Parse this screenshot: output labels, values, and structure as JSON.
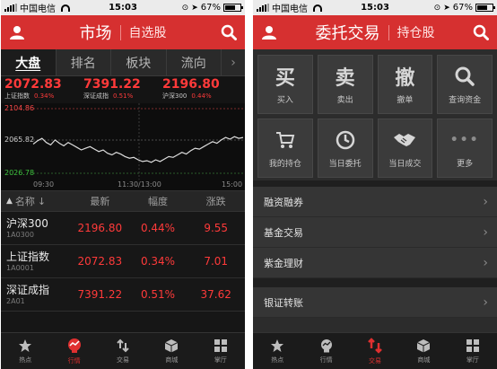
{
  "status_bar": {
    "carrier": "中国电信",
    "time": "15:03",
    "battery": "67%",
    "battery_level": 0.67
  },
  "market_screen": {
    "title": "市场",
    "subtitle": "自选股",
    "tabs": [
      "大盘",
      "排名",
      "板块",
      "流向"
    ],
    "tab_more": "›",
    "indices": [
      {
        "price": "2072.83",
        "name": "上证指数",
        "pct": "0.34%"
      },
      {
        "price": "7391.22",
        "name": "深证成指",
        "pct": "0.51%"
      },
      {
        "price": "2196.80",
        "name": "沪深300",
        "pct": "0.44%"
      }
    ],
    "chart_data": {
      "type": "line",
      "y_labels": [
        "2104.86",
        "2065.82",
        "2026.78"
      ],
      "ylim": [
        2026.78,
        2104.86
      ],
      "x_labels": [
        "09:30",
        "11:30/13:00",
        "15:00"
      ],
      "values": [
        2062,
        2066,
        2069,
        2064,
        2061,
        2067,
        2063,
        2060,
        2064,
        2061,
        2058,
        2055,
        2057,
        2059,
        2056,
        2053,
        2055,
        2051,
        2049,
        2052,
        2050,
        2047,
        2045,
        2046,
        2043,
        2041,
        2042,
        2040,
        2043,
        2041,
        2044,
        2047,
        2046,
        2049,
        2052,
        2050,
        2054,
        2057,
        2056,
        2059,
        2062,
        2065,
        2063,
        2067,
        2070,
        2068,
        2071,
        2069,
        2070
      ]
    },
    "list_header": {
      "name": "名称",
      "sort_glyph": "↓",
      "latest": "最新",
      "change": "幅度",
      "rise": "涨跌"
    },
    "stocks": [
      {
        "name": "沪深300",
        "code": "1A0300",
        "latest": "2196.80",
        "change": "0.44%",
        "rise": "9.55"
      },
      {
        "name": "上证指数",
        "code": "1A0001",
        "latest": "2072.83",
        "change": "0.34%",
        "rise": "7.01"
      },
      {
        "name": "深证成指",
        "code": "2A01",
        "latest": "7391.22",
        "change": "0.51%",
        "rise": "37.62"
      }
    ],
    "nav": [
      {
        "label": "热点",
        "icon": "star-icon",
        "active": false
      },
      {
        "label": "行情",
        "icon": "quote-icon",
        "active": true
      },
      {
        "label": "交易",
        "icon": "exchange-icon",
        "active": false
      },
      {
        "label": "商城",
        "icon": "box-icon",
        "active": false
      },
      {
        "label": "掌厅",
        "icon": "grid-icon",
        "active": false
      }
    ]
  },
  "trade_screen": {
    "title": "委托交易",
    "subtitle": "持仓股",
    "tiles": [
      {
        "glyph": "买",
        "label": "买入"
      },
      {
        "glyph": "卖",
        "label": "卖出"
      },
      {
        "glyph": "撤",
        "label": "撤单"
      },
      {
        "glyph": "search",
        "label": "查询资金"
      },
      {
        "glyph": "cart",
        "label": "我的持仓"
      },
      {
        "glyph": "clock",
        "label": "当日委托"
      },
      {
        "glyph": "handshake",
        "label": "当日成交"
      },
      {
        "glyph": "•••",
        "label": "更多"
      }
    ],
    "menu_group_1": [
      "融资融券",
      "基金交易",
      "紫金理财"
    ],
    "menu_group_2": [
      "银证转账"
    ],
    "nav": [
      {
        "label": "热点",
        "icon": "star-icon",
        "active": false
      },
      {
        "label": "行情",
        "icon": "quote-icon",
        "active": false
      },
      {
        "label": "交易",
        "icon": "exchange-icon",
        "active": true
      },
      {
        "label": "商城",
        "icon": "box-icon",
        "active": false
      },
      {
        "label": "掌厅",
        "icon": "grid-icon",
        "active": false
      }
    ]
  },
  "colors": {
    "brand_red": "#d63030",
    "up_red": "#ff3a3a",
    "chart_line": "#dcdcdc",
    "low_label": "#3ec43e"
  }
}
